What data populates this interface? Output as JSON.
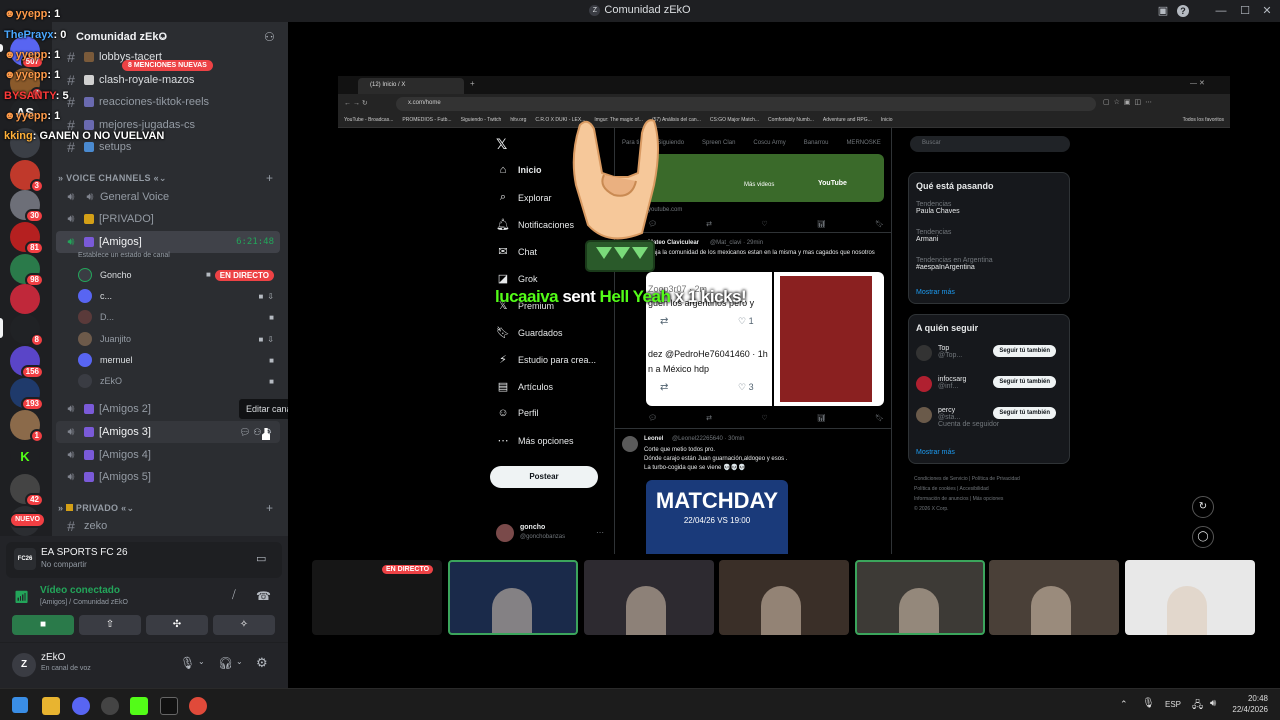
{
  "window": {
    "title": "Comunidad zEkO",
    "server_name": "Comunidad zEkO",
    "min_label": "—",
    "max_label": "☐",
    "close_label": "✕"
  },
  "chat_overlay": [
    {
      "user": "yyepp",
      "count": "1"
    },
    {
      "user": "ThePrayx",
      "count": "0"
    },
    {
      "user": "yyepp",
      "count": "1"
    },
    {
      "user": "yyepp",
      "count": "1"
    },
    {
      "user": "BYSANTY",
      "count": "5"
    },
    {
      "user": "yyepp",
      "count": "1"
    },
    {
      "user": "kking",
      "message": "GANEN O NO VUELVAN"
    }
  ],
  "servers": [
    {
      "badge": "507",
      "color": "#5865f2"
    },
    {
      "badge": "4",
      "color": "#8a5a2b"
    },
    {
      "badge": "",
      "label": "AS",
      "color": "#202225"
    },
    {
      "badge": "",
      "color": "#3b3f46"
    },
    {
      "badge": "3",
      "color": "#c0392b"
    },
    {
      "badge": "30",
      "color": "#6d6f78"
    },
    {
      "badge": "81",
      "color": "#b52020"
    },
    {
      "badge": "98",
      "color": "#2a7a4a"
    },
    {
      "badge": "",
      "color": "#c0283a"
    },
    {
      "badge": "8",
      "color": "#202225"
    },
    {
      "badge": "156",
      "color": "#5a45c8"
    },
    {
      "badge": "193",
      "color": "#1f3a6b"
    },
    {
      "badge": "1",
      "color": "#8b6a4a"
    },
    {
      "badge": "",
      "label": "K",
      "color": "#1e1f22"
    },
    {
      "badge": "42",
      "color": "#444"
    },
    {
      "badge": "NUEVO",
      "color": "#2b2d31"
    }
  ],
  "mentions_banner": "8 MENCIONES NUEVAS",
  "text_channels": [
    "lobbys-tacert",
    "clash-royale-mazos",
    "reacciones-tiktok-reels",
    "mejores-jugadas-cs",
    "setups"
  ],
  "voice_category": "VOICE CHANNELS",
  "voice_channels": {
    "general": "General Voice",
    "privado": "[PRIVADO]",
    "amigos": "[Amigos]",
    "amigos_timer": "6:21:48",
    "amigos_status": "Establece un estado de canal",
    "amigos2": "[Amigos 2]",
    "amigos3": "[Amigos 3]",
    "amigos4": "[Amigos 4]",
    "amigos5": "[Amigos 5]"
  },
  "members": [
    {
      "name": "Goncho",
      "live": "EN DIRECTO",
      "color": "#3a3c43"
    },
    {
      "name": "c...",
      "color": "#5865f2"
    },
    {
      "name": "D...",
      "color": "#5a3a3a"
    },
    {
      "name": "Juanjito",
      "color": "#6d5a4a"
    },
    {
      "name": "mernuel",
      "color": "#5865f2"
    },
    {
      "name": "zEkO",
      "color": "#3a3c43"
    }
  ],
  "tooltip": "Editar canal",
  "private_category": "PRIVADO",
  "private_channel": "zeko",
  "activity": {
    "game": "EA SPORTS FC 26",
    "sub": "No compartir",
    "icon": "FC26"
  },
  "voice_status": {
    "title": "Vídeo conectado",
    "sub": "[Amigos] / Comunidad zEkO"
  },
  "user": {
    "name": "zEkO",
    "status": "En canal de voz"
  },
  "browser": {
    "tab": "(12) Inicio / X",
    "url": "x.com/home",
    "bookmarks": [
      "YouTube - Broadcas...",
      "PROMEDIOS - Futb...",
      "Siguiendo - Twitch",
      "hltv.org",
      "C.R.O X DUKI - LEX...",
      "Imgur: The magic of...",
      "(57) Análisis del can...",
      "CS:GO Major Match...",
      "Comfortably Numb...",
      "Adventure and RPG...",
      "Inicio",
      "Todos los favoritos"
    ],
    "nav": [
      "Inicio",
      "Explorar",
      "Notificaciones",
      "Chat",
      "Grok",
      "Premium",
      "Guardados",
      "Estudio para crea...",
      "Artículos",
      "Perfil",
      "Más opciones"
    ],
    "post_button": "Postear",
    "account_name": "goncho",
    "account_handle": "@gonchobanzas",
    "tabs": [
      "Para ti",
      "Siguiendo",
      "Spreen Clan",
      "Coscu Army",
      "Banarrou",
      "MERNOSKE"
    ],
    "video_more": "Más videos",
    "video_brand": "YouTube",
    "video_domain": "youtube.com",
    "tweet1_author": "Mateo Claviculear",
    "tweet1_handle": "@Mat_clavi · 29min",
    "tweet1_text": "ojaja la comunidad de los mexicanos estan en la misma y mas cagados que nosotros",
    "quote_a": "Zoop3r07 · 2m",
    "quote_b": "guen los argentinos pero y",
    "quote_c": "dez @PedroHe76041460 · 1h",
    "quote_d": "n a México hdp",
    "quote_count1": "1",
    "quote_count2": "3",
    "tweet2_author": "Leonel",
    "tweet2_handle": "@Leonel22265640 · 30min",
    "tweet2_lines": [
      "Corte que metio todos pro.",
      "Dónde carajo están Juan guarnación,aldogeo y esos .",
      "La turbo-cogida que se viene 💀💀💀"
    ],
    "match_title": "MATCHDAY",
    "match_date": "22/04/26",
    "match_time": "19:00",
    "match_vs": "VS",
    "search_placeholder": "Buscar",
    "trends_title": "Qué está pasando",
    "trends": [
      {
        "label": "Tendencias",
        "name": "Paula Chaves"
      },
      {
        "label": "Tendencias",
        "name": "Armani"
      },
      {
        "label": "Tendencias en Argentina",
        "name": "#aespaInArgentina"
      }
    ],
    "show_more": "Mostrar más",
    "who_title": "A quién seguir",
    "follow": [
      {
        "name": "Top",
        "handle": "@Top..."
      },
      {
        "name": "infocsarg",
        "handle": "@inf..."
      },
      {
        "name": "percy",
        "handle": "@sta...",
        "extra": "Cuenta de seguidor"
      }
    ],
    "follow_btn": "Seguir tú también",
    "show_more2": "Mostrar más",
    "footer": [
      "Condiciones de Servicio",
      "Política de Privacidad",
      "Política de cookies",
      "Accesibilidad",
      "Información de anuncios",
      "Más opciones",
      "© 2026 X Corp."
    ]
  },
  "kick_alert": {
    "user": "lucaaiva",
    "action": "sent",
    "gift": "Hell Yeah",
    "suffix": "x 1 kicks!"
  },
  "thumbnails": [
    {
      "label": "EN DIRECTO",
      "color": "#161616"
    },
    {
      "color": "#1a2a4a",
      "active": true
    },
    {
      "color": "#2d2a30"
    },
    {
      "color": "#3a2f28"
    },
    {
      "color": "#3d3a36",
      "active": true
    },
    {
      "color": "#4a4038"
    },
    {
      "color": "#e8e8e8"
    }
  ],
  "taskbar": {
    "lang": "ESP",
    "time": "20:48",
    "date": "22/4/2026"
  },
  "colors": {
    "accent": "#5865f2",
    "danger": "#ed4245",
    "green": "#23a55a"
  }
}
